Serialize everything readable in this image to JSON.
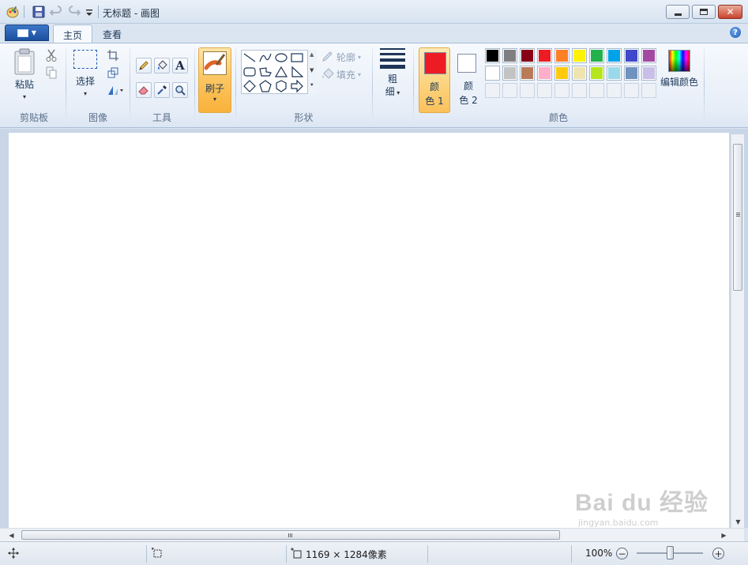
{
  "window": {
    "title": "无标题 - 画图"
  },
  "tabs": [
    {
      "label": "主页",
      "active": true
    },
    {
      "label": "查看",
      "active": false
    }
  ],
  "ribbon": {
    "clipboard": {
      "group_label": "剪贴板",
      "paste_label": "粘贴"
    },
    "image": {
      "group_label": "图像",
      "select_label": "选择"
    },
    "tools": {
      "group_label": "工具"
    },
    "brushes": {
      "label": "刷子"
    },
    "shapes": {
      "group_label": "形状",
      "outline_label": "轮廓",
      "fill_label": "填充"
    },
    "size": {
      "label_line1": "粗",
      "label_line2": "细"
    },
    "colors": {
      "group_label": "颜色",
      "color1_line1": "颜",
      "color1_line2": "色 1",
      "color1_value": "#ed1c24",
      "color2_line1": "颜",
      "color2_line2": "色 2",
      "color2_value": "#ffffff",
      "edit_label": "编辑颜色",
      "palette_row1": [
        "#000000",
        "#7f7f7f",
        "#880015",
        "#ed1c24",
        "#ff7f27",
        "#fff200",
        "#22b14c",
        "#00a2e8",
        "#3f48cc",
        "#a349a4"
      ],
      "palette_row2": [
        "#ffffff",
        "#c3c3c3",
        "#b97a57",
        "#ffaec9",
        "#ffc90e",
        "#efe4b0",
        "#b5e61d",
        "#99d9ea",
        "#7092be",
        "#c8bfe7"
      ]
    }
  },
  "status": {
    "dimensions": "1169 × 1284像素",
    "zoom": "100%"
  },
  "colors": {
    "accent": "#1b4f9c",
    "workspace": "#c8d6e8"
  },
  "watermark": {
    "text": "Bai du 经验",
    "sub": "jingyan.baidu.com"
  }
}
